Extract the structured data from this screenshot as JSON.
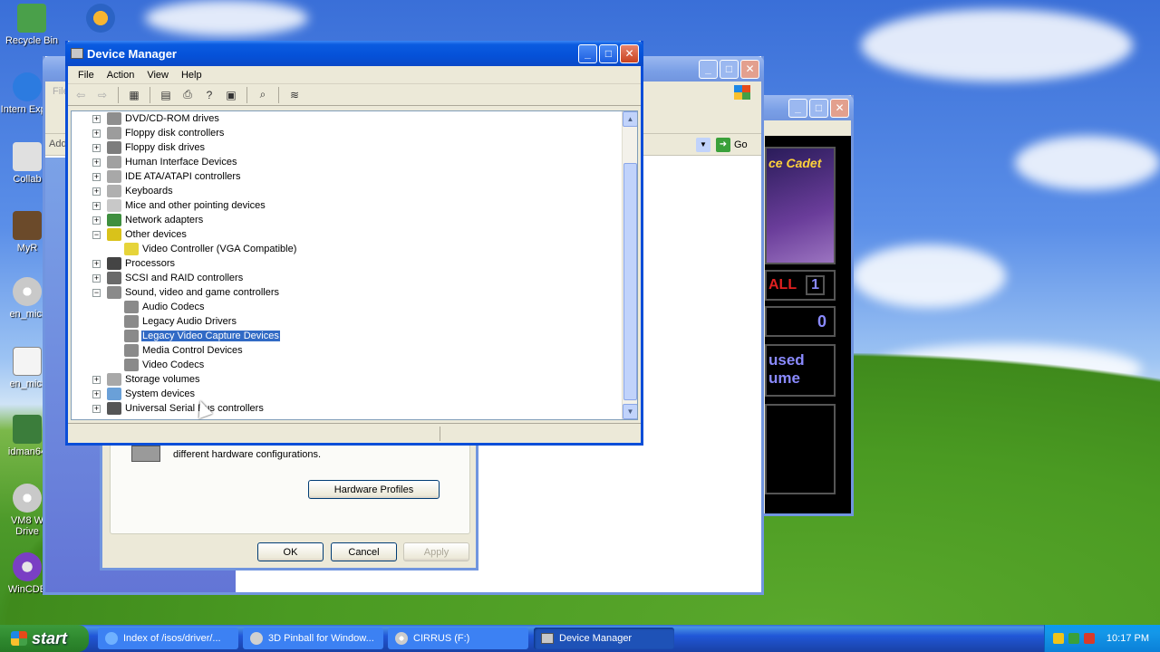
{
  "desktop": {
    "icons": [
      {
        "label": "Recycle Bin"
      },
      {
        "label": "Intern Explo"
      },
      {
        "label": "Collab"
      },
      {
        "label": "MyR"
      },
      {
        "label": "en_micr"
      },
      {
        "label": "en_micr"
      },
      {
        "label": "idman64"
      },
      {
        "label": "VM8 W Drive"
      },
      {
        "label": "WinCDE"
      }
    ]
  },
  "explorer_window": {
    "menu_label": "File",
    "address_hint": "Add",
    "go_label": "Go"
  },
  "system_properties": {
    "hardware_profiles_text": "different hardware configurations.",
    "hardware_profiles_button": "Hardware Profiles",
    "ok": "OK",
    "cancel": "Cancel",
    "apply": "Apply"
  },
  "pinball": {
    "ball_label": "ALL",
    "ball_number": "1",
    "score": "0",
    "status_line1": "used",
    "status_line2": "ume",
    "logo_text": "ce Cadet"
  },
  "device_manager": {
    "title": "Device Manager",
    "menu": [
      "File",
      "Action",
      "View",
      "Help"
    ],
    "tree": [
      {
        "label": "DVD/CD-ROM drives",
        "expanded": false,
        "level": 0,
        "icon": "dvd-drive-icon",
        "color": "#8e8e8e"
      },
      {
        "label": "Floppy disk controllers",
        "expanded": false,
        "level": 0,
        "icon": "floppy-controller-icon",
        "color": "#9c9c9c"
      },
      {
        "label": "Floppy disk drives",
        "expanded": false,
        "level": 0,
        "icon": "floppy-drive-icon",
        "color": "#7d7d7d"
      },
      {
        "label": "Human Interface Devices",
        "expanded": false,
        "level": 0,
        "icon": "hid-icon",
        "color": "#a0a0a0"
      },
      {
        "label": "IDE ATA/ATAPI controllers",
        "expanded": false,
        "level": 0,
        "icon": "ide-controller-icon",
        "color": "#a8a8a8"
      },
      {
        "label": "Keyboards",
        "expanded": false,
        "level": 0,
        "icon": "keyboard-icon",
        "color": "#b0b0b0"
      },
      {
        "label": "Mice and other pointing devices",
        "expanded": false,
        "level": 0,
        "icon": "mouse-icon",
        "color": "#c8c8c8"
      },
      {
        "label": "Network adapters",
        "expanded": false,
        "level": 0,
        "icon": "network-adapter-icon",
        "color": "#3f8f3f"
      },
      {
        "label": "Other devices",
        "expanded": true,
        "level": 0,
        "icon": "other-devices-icon",
        "color": "#d9c21a"
      },
      {
        "label": "Video Controller (VGA Compatible)",
        "expanded": null,
        "level": 1,
        "icon": "unknown-device-warning-icon",
        "color": "#e6d43a"
      },
      {
        "label": "Processors",
        "expanded": false,
        "level": 0,
        "icon": "processor-icon",
        "color": "#444444"
      },
      {
        "label": "SCSI and RAID controllers",
        "expanded": false,
        "level": 0,
        "icon": "scsi-controller-icon",
        "color": "#6a6a6a"
      },
      {
        "label": "Sound, video and game controllers",
        "expanded": true,
        "level": 0,
        "icon": "sound-icon",
        "color": "#8a8a8a"
      },
      {
        "label": "Audio Codecs",
        "expanded": null,
        "level": 1,
        "icon": "audio-codec-icon",
        "color": "#8a8a8a"
      },
      {
        "label": "Legacy Audio Drivers",
        "expanded": null,
        "level": 1,
        "icon": "legacy-audio-icon",
        "color": "#8a8a8a"
      },
      {
        "label": "Legacy Video Capture Devices",
        "expanded": null,
        "level": 1,
        "icon": "video-capture-icon",
        "color": "#8a8a8a",
        "selected": true
      },
      {
        "label": "Media Control Devices",
        "expanded": null,
        "level": 1,
        "icon": "media-control-icon",
        "color": "#8a8a8a"
      },
      {
        "label": "Video Codecs",
        "expanded": null,
        "level": 1,
        "icon": "video-codec-icon",
        "color": "#8a8a8a"
      },
      {
        "label": "Storage volumes",
        "expanded": false,
        "level": 0,
        "icon": "storage-volume-icon",
        "color": "#a8a8a8"
      },
      {
        "label": "System devices",
        "expanded": false,
        "level": 0,
        "icon": "system-device-icon",
        "color": "#6aa0d8"
      },
      {
        "label": "Universal Serial Bus controllers",
        "expanded": false,
        "level": 0,
        "icon": "usb-icon",
        "color": "#555555"
      }
    ]
  },
  "taskbar": {
    "start_label": "start",
    "items": [
      {
        "label": "Index of /isos/driver/...",
        "icon": "ie-icon"
      },
      {
        "label": "3D Pinball for Window...",
        "icon": "pinball-icon"
      },
      {
        "label": "CIRRUS (F:)",
        "icon": "cd-drive-icon"
      },
      {
        "label": "Device Manager",
        "icon": "device-manager-icon",
        "active": true
      }
    ],
    "clock": "10:17 PM"
  }
}
